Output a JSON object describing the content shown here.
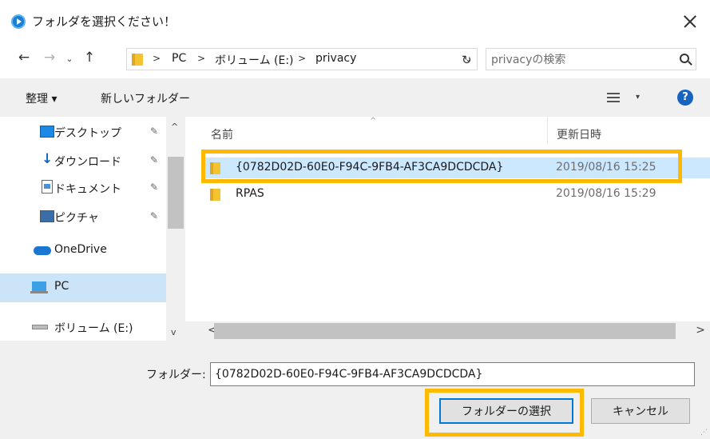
{
  "window": {
    "title": "フォルダを選択ください！",
    "close_icon": "close-icon"
  },
  "navigation": {
    "breadcrumb": [
      "PC",
      "ボリューム (E:)",
      "privacy"
    ],
    "search_placeholder": "privacyの検索"
  },
  "toolbar": {
    "organize_label": "整理 ▾",
    "new_folder_label": "新しいフォルダー"
  },
  "nav_pane": {
    "items": [
      {
        "label": "デスクトップ",
        "icon": "desktop-icon",
        "pinned": true
      },
      {
        "label": "ダウンロード",
        "icon": "download-icon",
        "pinned": true
      },
      {
        "label": "ドキュメント",
        "icon": "document-icon",
        "pinned": true
      },
      {
        "label": "ピクチャ",
        "icon": "pictures-icon",
        "pinned": true
      },
      {
        "label": "OneDrive",
        "icon": "cloud-icon",
        "pinned": false
      },
      {
        "label": "PC",
        "icon": "pc-icon",
        "pinned": false,
        "selected": true
      },
      {
        "label": "ボリューム (E:)",
        "icon": "drive-icon",
        "pinned": false
      }
    ]
  },
  "file_list": {
    "columns": [
      "名前",
      "更新日時"
    ],
    "rows": [
      {
        "name": "{0782D02D-60E0-F94C-9FB4-AF3CA9DCDCDA}",
        "date": "2019/08/16 15:25",
        "selected": true
      },
      {
        "name": "RPAS",
        "date": "2019/08/16 15:29",
        "selected": false
      }
    ]
  },
  "footer": {
    "folder_label": "フォルダー:",
    "folder_value": "{0782D02D-60E0-F94C-9FB4-AF3CA9DCDCDA}",
    "select_button": "フォルダーの選択",
    "cancel_button": "キャンセル"
  },
  "highlight_color": "#ffb900",
  "selection_color": "#cce8ff"
}
